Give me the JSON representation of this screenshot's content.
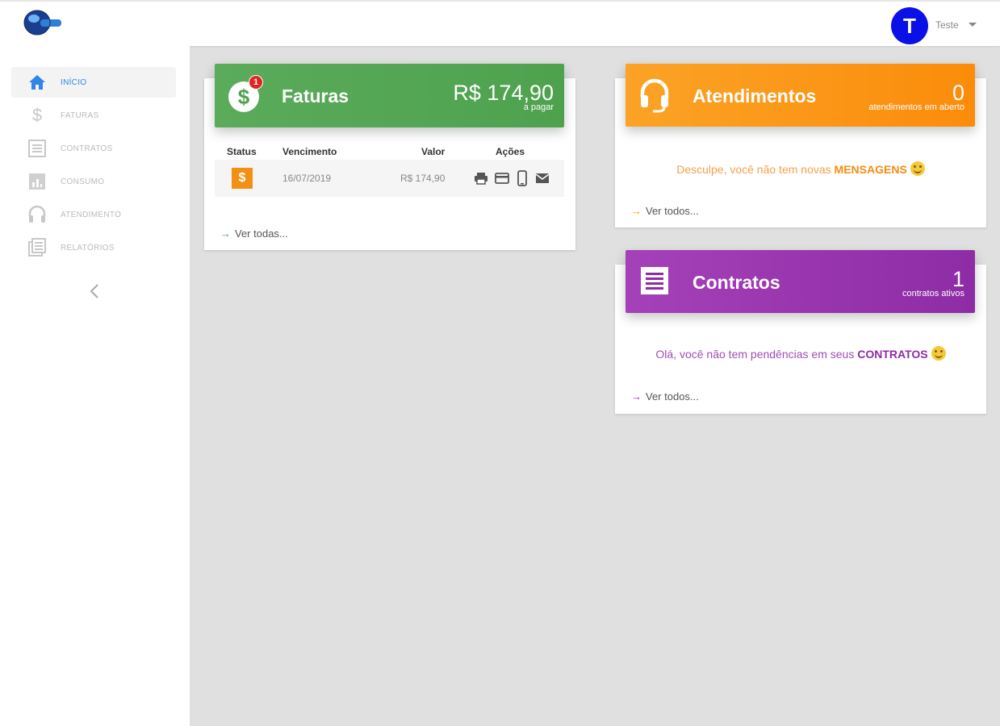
{
  "topbar": {
    "user_initial": "T",
    "user_name": "Teste"
  },
  "sidebar": {
    "items": [
      {
        "label": "INÍCIO",
        "icon": "home-icon",
        "active": true
      },
      {
        "label": "FATURAS",
        "icon": "dollar-icon"
      },
      {
        "label": "CONTRATOS",
        "icon": "document-list-icon"
      },
      {
        "label": "CONSUMO",
        "icon": "bar-chart-icon"
      },
      {
        "label": "ATENDIMENTO",
        "icon": "headset-icon"
      },
      {
        "label": "RELATÓRIOS",
        "icon": "reports-icon"
      }
    ],
    "collapse_icon": "chevron-left-icon"
  },
  "faturas": {
    "title": "Faturas",
    "badge_count": "1",
    "amount": "R$ 174,90",
    "amount_sub": "a pagar",
    "columns": [
      "Status",
      "Vencimento",
      "Valor",
      "Ações"
    ],
    "rows": [
      {
        "status_symbol": "$",
        "due": "16/07/2019",
        "value": "R$ 174,90"
      }
    ],
    "actions": [
      "print-icon",
      "credit-card-icon",
      "smartphone-icon",
      "email-icon"
    ],
    "link": "Ver todas...",
    "color": "#4ea24e"
  },
  "atendimentos": {
    "title": "Atendimentos",
    "count": "0",
    "count_sub": "atendimentos em aberto",
    "message_prefix": "Desculpe, você não tem novas",
    "message_bold": "MENSAGENS",
    "link": "Ver todos...",
    "color": "#fb8c0a"
  },
  "contratos": {
    "title": "Contratos",
    "count": "1",
    "count_sub": "contratos ativos",
    "message_prefix": "Olá, você não tem pendências em seus",
    "message_bold": "CONTRATOS",
    "link": "Ver todos...",
    "color": "#8e2ca6"
  }
}
